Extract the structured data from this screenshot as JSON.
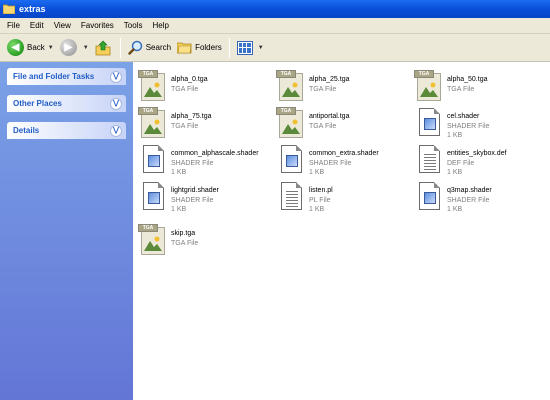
{
  "window": {
    "title": "extras"
  },
  "menu": [
    "File",
    "Edit",
    "View",
    "Favorites",
    "Tools",
    "Help"
  ],
  "toolbar": {
    "back_label": "Back",
    "search_label": "Search",
    "folders_label": "Folders"
  },
  "sidebar": {
    "panels": [
      {
        "title": "File and Folder Tasks"
      },
      {
        "title": "Other Places"
      },
      {
        "title": "Details"
      }
    ]
  },
  "files": [
    {
      "name": "alpha_0.tga",
      "type": "TGA File",
      "size": "",
      "icon": "tga-icon"
    },
    {
      "name": "alpha_25.tga",
      "type": "TGA File",
      "size": "",
      "icon": "tga-icon"
    },
    {
      "name": "alpha_50.tga",
      "type": "TGA File",
      "size": "",
      "icon": "tga-icon"
    },
    {
      "name": "alpha_75.tga",
      "type": "TGA File",
      "size": "",
      "icon": "tga-icon"
    },
    {
      "name": "antiportal.tga",
      "type": "TGA File",
      "size": "",
      "icon": "tga-icon"
    },
    {
      "name": "cel.shader",
      "type": "SHADER File",
      "size": "1 KB",
      "icon": "shader-file-icon"
    },
    {
      "name": "common_alphascale.shader",
      "type": "SHADER File",
      "size": "1 KB",
      "icon": "shader-file-icon"
    },
    {
      "name": "common_extra.shader",
      "type": "SHADER File",
      "size": "1 KB",
      "icon": "shader-file-icon"
    },
    {
      "name": "entities_skybox.def",
      "type": "DEF File",
      "size": "1 KB",
      "icon": "text-file-icon"
    },
    {
      "name": "lightgrid.shader",
      "type": "SHADER File",
      "size": "1 KB",
      "icon": "shader-file-icon"
    },
    {
      "name": "listen.pl",
      "type": "PL File",
      "size": "1 KB",
      "icon": "text-file-icon"
    },
    {
      "name": "q3map.shader",
      "type": "SHADER File",
      "size": "1 KB",
      "icon": "shader-file-icon"
    },
    {
      "name": "skip.tga",
      "type": "TGA File",
      "size": "",
      "icon": "tga-icon"
    }
  ]
}
